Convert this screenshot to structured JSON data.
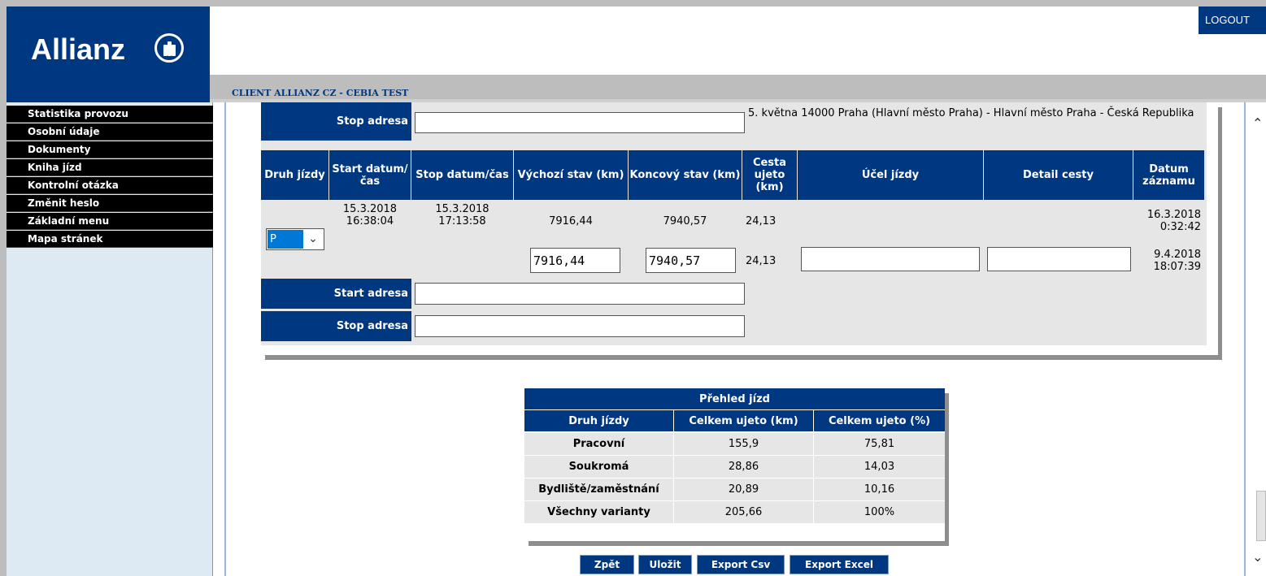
{
  "brand": {
    "logo_text": "Allianz",
    "logo_icon": "allianz-emblem-icon"
  },
  "header": {
    "logout_label": "LOGOUT",
    "client_label": "CLIENT ALLIANZ CZ - CEBIA TEST"
  },
  "sidebar": {
    "items": [
      {
        "label": "Statistika provozu"
      },
      {
        "label": "Osobní údaje"
      },
      {
        "label": "Dokumenty"
      },
      {
        "label": "Kniha jízd"
      },
      {
        "label": "Kontrolní otázka"
      },
      {
        "label": "Změnit heslo"
      },
      {
        "label": "Základní menu"
      },
      {
        "label": "Mapa stránek"
      }
    ]
  },
  "trip": {
    "top_stop_label": "Stop adresa",
    "top_stop_value": "",
    "top_stop_text": "5. května 14000 Praha (Hlavní město Praha) - Hlavní město Praha - Česká Republika",
    "columns": [
      "Druh jízdy",
      "Start datum/čas",
      "Stop datum/čas",
      "Výchozí stav (km)",
      "Koncový stav (km)",
      "Cesta ujeto (km)",
      "Účel jízdy",
      "Detail cesty",
      "Datum záznamu"
    ],
    "druh_selected": "P",
    "row1": {
      "start": "15.3.2018 16:38:04",
      "stop": "15.3.2018 17:13:58",
      "vychozi": "7916,44",
      "koncovy": "7940,57",
      "cesta": "24,13",
      "datum": "16.3.2018 0:32:42"
    },
    "row2": {
      "vychozi": "7916,44",
      "koncovy": "7940,57",
      "cesta": "24,13",
      "ucel": "",
      "detail": "",
      "datum": "9.4.2018 18:07:39"
    },
    "start_label": "Start adresa",
    "start_value": "",
    "stop_label": "Stop adresa",
    "stop_value": ""
  },
  "summary": {
    "title": "Přehled jízd",
    "columns": [
      "Druh jízdy",
      "Celkem ujeto (km)",
      "Celkem ujeto (%)"
    ],
    "rows": [
      {
        "druh": "Pracovní",
        "km": "155,9",
        "pct": "75,81"
      },
      {
        "druh": "Soukromá",
        "km": "28,86",
        "pct": "14,03"
      },
      {
        "druh": "Bydliště/zaměstnání",
        "km": "20,89",
        "pct": "10,16"
      },
      {
        "druh": "Všechny varianty",
        "km": "205,66",
        "pct": "100%"
      }
    ]
  },
  "actions": {
    "back": "Zpět",
    "save": "Uložit",
    "export_csv": "Export Csv",
    "export_excel": "Export Excel"
  },
  "colors": {
    "brand_blue": "#003781",
    "panel_gray": "#e6e6e6",
    "sidebar_bg": "#dde9f3"
  }
}
